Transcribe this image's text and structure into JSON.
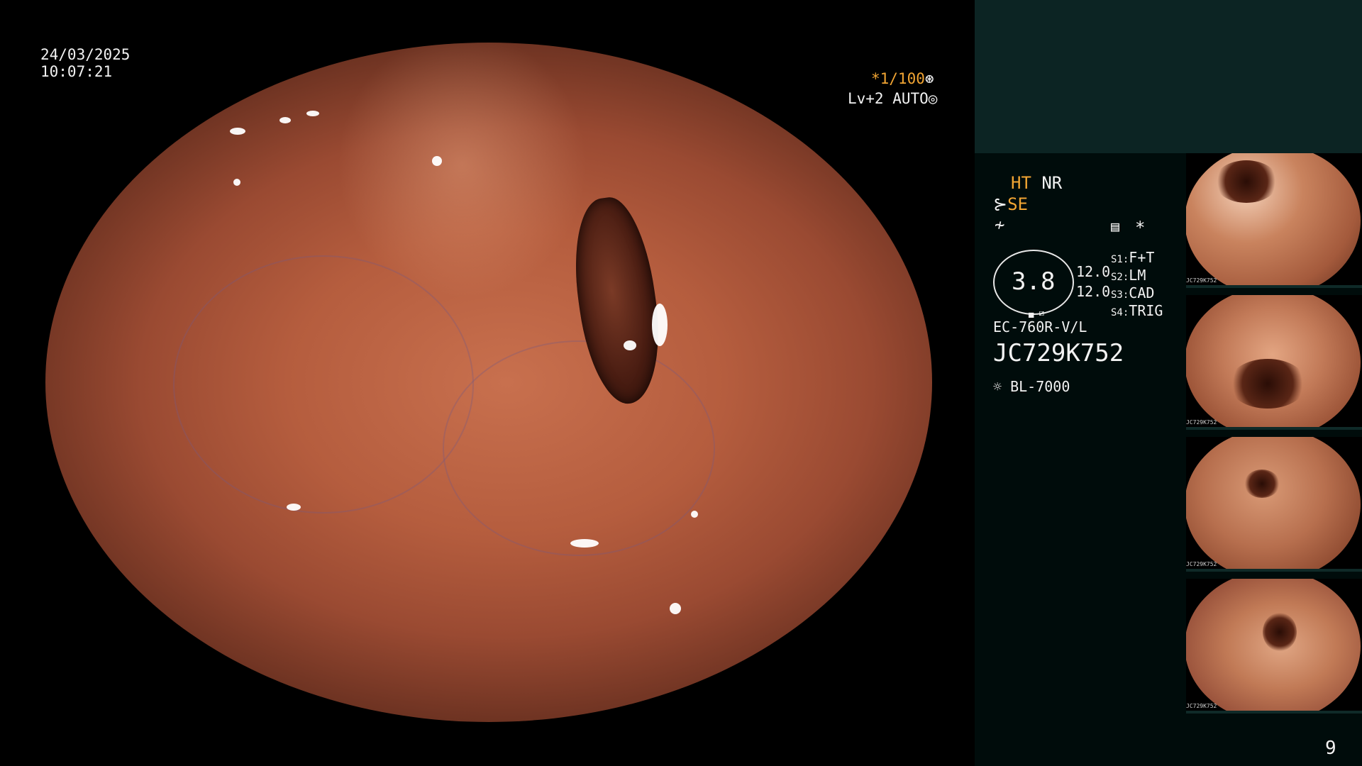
{
  "datetime": {
    "date": "24/03/2025",
    "time": "10:07:21"
  },
  "scope_overlay": {
    "shutter": "*1/100",
    "level": "Lv+2 AUTO"
  },
  "panel": {
    "modes_line1": {
      "ht": "HT",
      "nr": "NR"
    },
    "modes_line2": {
      "se": "SE"
    },
    "star": "*",
    "zoom_value": "3.8",
    "values": [
      "12.0",
      "12.0"
    ],
    "switches": [
      {
        "key": "S1:",
        "label": "F+T"
      },
      {
        "key": "S2:",
        "label": "LM"
      },
      {
        "key": "S3:",
        "label": "CAD"
      },
      {
        "key": "S4:",
        "label": "TRIG"
      }
    ],
    "scope_model": "EC-760R-V/L",
    "serial": "JC729K752",
    "light_source": "BL-7000"
  },
  "thumbnails": [
    {
      "serial": "JC729K752"
    },
    {
      "serial": "JC729K752"
    },
    {
      "serial": "JC729K752"
    },
    {
      "serial": "JC729K752"
    }
  ],
  "page_number": "9",
  "icons": [
    "aperture-icon",
    "iris-icon",
    "scope-icon",
    "tilde-icon",
    "memo-icon",
    "lamp-icon"
  ]
}
